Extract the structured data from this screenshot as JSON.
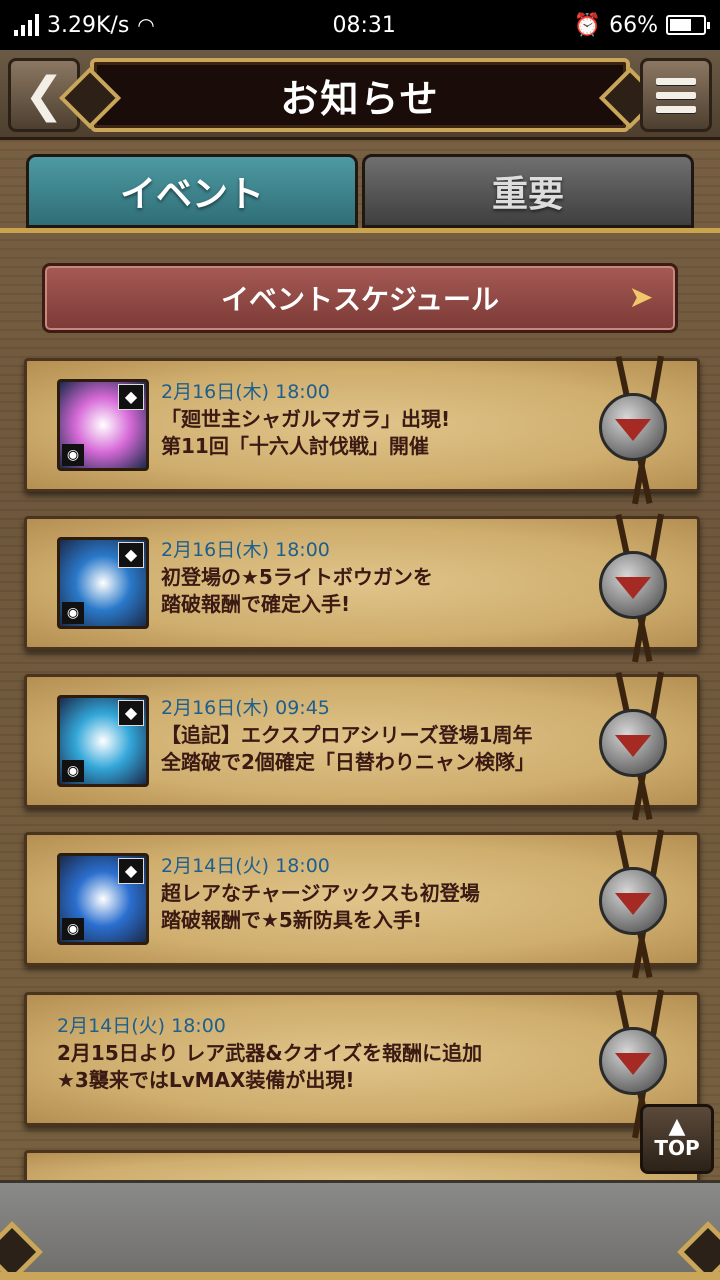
{
  "status_bar": {
    "speed": "3.29K/s",
    "time": "08:31",
    "battery": "66%",
    "battery_level": 0.66
  },
  "header": {
    "back_label": "<",
    "title": "お知らせ"
  },
  "tabs": [
    {
      "label": "イベント",
      "active": true
    },
    {
      "label": "重要",
      "active": false
    }
  ],
  "schedule_button": {
    "label": "イベントスケジュール"
  },
  "news": [
    {
      "date": "2月16日(木) 18:00",
      "line1": "「廻世主シャガルマガラ」出現!",
      "line2": "第11回「十六人討伐戦」開催",
      "thumb_color": "#d66ad8",
      "has_thumb": true
    },
    {
      "date": "2月16日(木) 18:00",
      "line1": "初登場の★5ライトボウガンを",
      "line2": "踏破報酬で確定入手!",
      "thumb_color": "#2a79c9",
      "has_thumb": true
    },
    {
      "date": "2月16日(木) 09:45",
      "line1": "【追記】エクスプロアシリーズ登場1周年",
      "line2": "全踏破で2個確定「日替わりニャン検隊」",
      "thumb_color": "#33a7d9",
      "has_thumb": true
    },
    {
      "date": "2月14日(火) 18:00",
      "line1": "超レアなチャージアックスも初登場",
      "line2": "踏破報酬で★5新防具を入手!",
      "thumb_color": "#2b6fcf",
      "has_thumb": true
    },
    {
      "date": "2月14日(火) 18:00",
      "line1": "2月15日より レア武器&クオイズを報酬に追加",
      "line2": "★3襲来ではLvMAX装備が出現!",
      "thumb_color": "",
      "has_thumb": false
    }
  ],
  "top_button": {
    "label": "TOP"
  }
}
